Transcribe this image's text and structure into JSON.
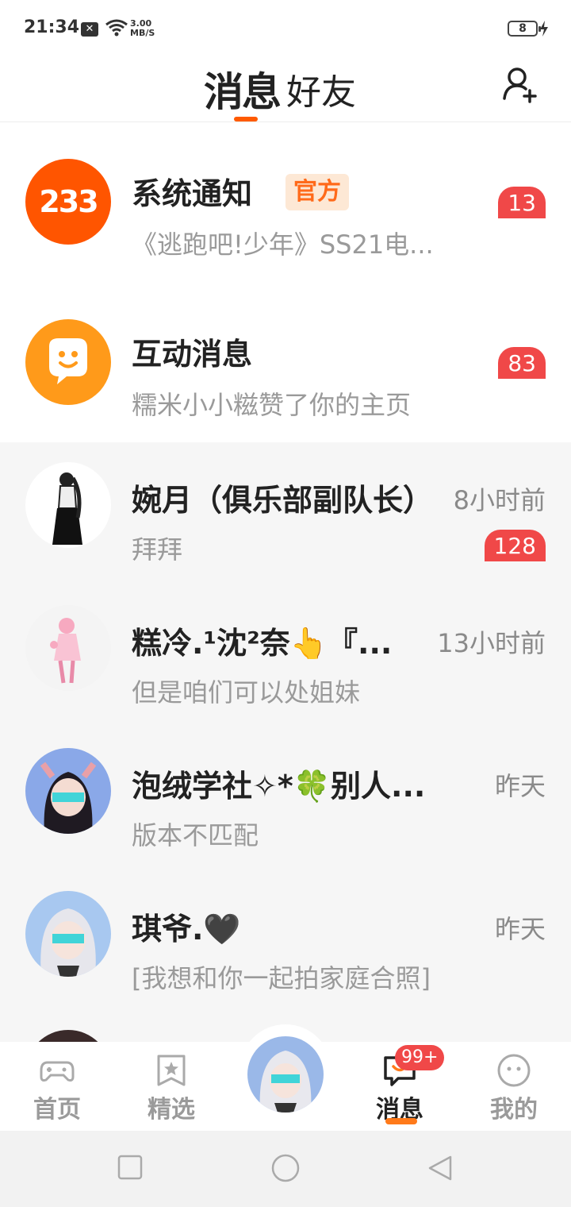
{
  "status_bar": {
    "time": "21:34",
    "speed_value": "3.00",
    "speed_unit": "MB/S",
    "battery": "8"
  },
  "header": {
    "tab_messages": "消息",
    "tab_friends": "好友",
    "add_friend_icon": "add-person-icon",
    "accent": "#ff5a00"
  },
  "official": [
    {
      "name": "系统通知",
      "tag": "官方",
      "message": "《逃跑吧!少年》SS21电...",
      "badge": "13",
      "avatar_text": "233",
      "avatar_color": "#ff5500"
    },
    {
      "name": "互动消息",
      "message": "糯米小小糍赞了你的主页",
      "badge": "83",
      "avatar_color": "#ff9a1a"
    }
  ],
  "chats": [
    {
      "name": "婉月（俱乐部副队长）",
      "time": "8小时前",
      "message": "拜拜",
      "badge": "128"
    },
    {
      "name": "糕冷.¹沈²奈👆『...",
      "time": "13小时前",
      "message": "但是咱们可以处姐妹"
    },
    {
      "name": "泡绒学社✧*🍀别人...",
      "time": "昨天",
      "message": "版本不匹配"
    },
    {
      "name": "琪爷.🖤",
      "time": "昨天",
      "message": "[我想和你一起拍家庭合照]"
    }
  ],
  "bottom_nav": {
    "home": "首页",
    "featured": "精选",
    "messages": "消息",
    "messages_badge": "99+",
    "mine": "我的"
  }
}
